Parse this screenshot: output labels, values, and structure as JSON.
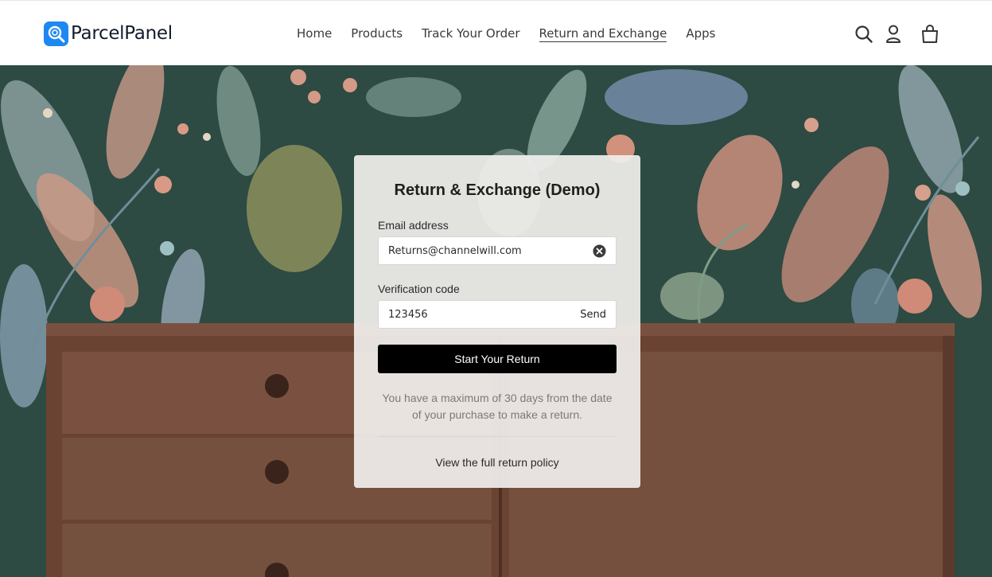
{
  "brand": {
    "name": "ParcelPanel",
    "logo_icon": "magnifier-logo-icon",
    "accent": "#1e88f2"
  },
  "nav": {
    "items": [
      {
        "label": "Home"
      },
      {
        "label": "Products"
      },
      {
        "label": "Track Your Order"
      },
      {
        "label": "Return and Exchange",
        "active": true
      },
      {
        "label": "Apps"
      }
    ]
  },
  "header_icons": [
    "search-icon",
    "account-icon",
    "cart-icon"
  ],
  "form": {
    "title": "Return & Exchange (Demo)",
    "email_label": "Email address",
    "email_value": "Returns@channelwill.com",
    "code_label": "Verification code",
    "code_value": "123456",
    "send_label": "Send",
    "submit_label": "Start Your Return",
    "note": "You have a maximum of 30 days from the date of your purchase to make a return.",
    "policy_link": "View the full return policy"
  },
  "colors": {
    "button": "#000000",
    "background_wall": "#2c4841",
    "furniture": "#6b4433"
  }
}
